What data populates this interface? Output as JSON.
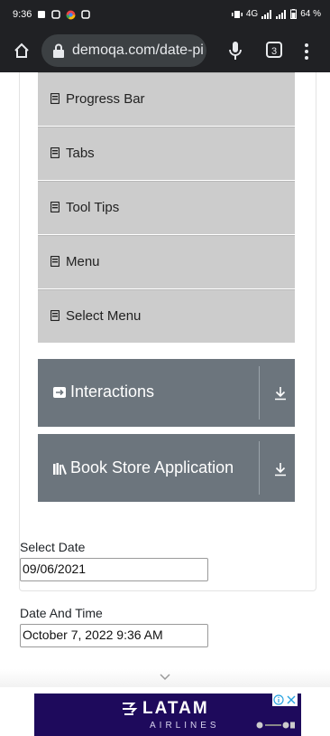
{
  "status_bar": {
    "time": "9:36",
    "network": "4G",
    "battery": "64 %"
  },
  "browser": {
    "url": "demoqa.com/date-pic",
    "tab_count": "3"
  },
  "menu": {
    "items": [
      {
        "label": "Progress Bar"
      },
      {
        "label": "Tabs"
      },
      {
        "label": "Tool Tips"
      },
      {
        "label": "Menu"
      },
      {
        "label": "Select Menu"
      }
    ],
    "groups": [
      {
        "label": "Interactions"
      },
      {
        "label": "Book Store Application"
      }
    ]
  },
  "form": {
    "select_date": {
      "label": "Select Date",
      "value": "09/06/2021"
    },
    "date_and_time": {
      "label": "Date And Time",
      "value": "October 7, 2022 9:36 AM"
    }
  },
  "ad": {
    "brand": "LATAM",
    "brand_sub": "AIRLINES"
  },
  "colors": {
    "menu_item_bg": "#cccccc",
    "group_bg": "#6c757d",
    "ad_bg": "#1e0a5c"
  }
}
